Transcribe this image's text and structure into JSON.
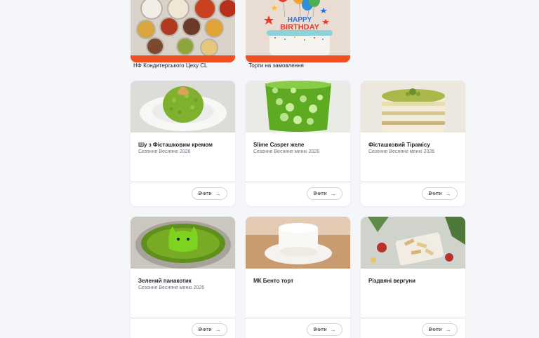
{
  "top_cards": [
    {
      "caption": "НФ Кондитерського Цеху CL"
    },
    {
      "caption": "Торти на замовлення",
      "cake_text_1": "HAPPY",
      "cake_text_2": "BIRTHDAY"
    }
  ],
  "cards": [
    {
      "title": "Шу з Фісташковим кремом",
      "subtitle": "Сезонне Весняне 2026",
      "button": "Вчити"
    },
    {
      "title": "Slime Casper желе",
      "subtitle": "Сезонне Весняне меню 2026",
      "button": "Вчити"
    },
    {
      "title": "Фісташковий Тірамісу",
      "subtitle": "Сезонне Весняне меню 2026",
      "button": "Вчити"
    },
    {
      "title": "Зелений панакотик",
      "subtitle": "Сезонне Весняне меню 2026",
      "button": "Вчити"
    },
    {
      "title": "МК Бенто торт",
      "subtitle": "",
      "button": "Вчити"
    },
    {
      "title": "Різдвяні вергуни",
      "subtitle": "",
      "button": "Вчити"
    }
  ],
  "colors": {
    "accent": "#f04e23",
    "background": "#f4f6fa"
  },
  "icons": {
    "button_arrow": "arrow-right-icon"
  }
}
